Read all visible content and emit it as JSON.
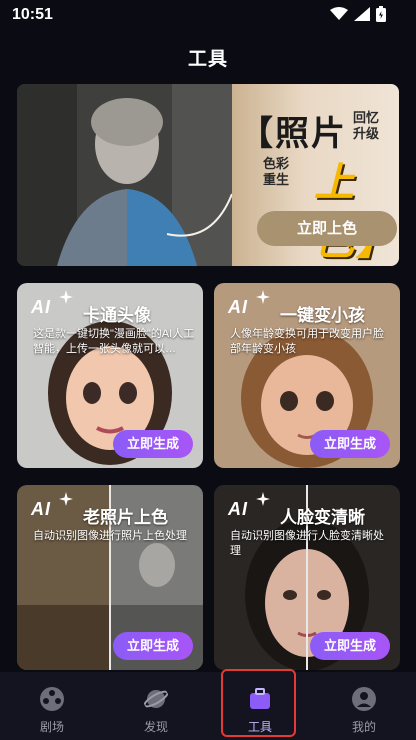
{
  "status": {
    "time": "10:51"
  },
  "header": {
    "title": "工具"
  },
  "banner": {
    "title_bracket": "【照片",
    "side_top": "回忆\n升级",
    "side_left": "色彩\n重生",
    "big_text": "上色】",
    "button_label": "立即上色"
  },
  "cards": [
    {
      "ai": "AI",
      "title": "卡通头像",
      "desc": "这是款一键切换\"漫画脸\"的AI人工智能，上传一张头像就可以…",
      "button": "立即生成"
    },
    {
      "ai": "AI",
      "title": "一键变小孩",
      "desc": "人像年龄变换可用于改变用户脸部年龄变小孩",
      "button": "立即生成"
    },
    {
      "ai": "AI",
      "title": "老照片上色",
      "desc": "自动识别图像进行照片上色处理",
      "button": "立即生成"
    },
    {
      "ai": "AI",
      "title": "人脸变清晰",
      "desc": "自动识别图像进行人脸变清晰处理",
      "button": "立即生成"
    }
  ],
  "nav": [
    {
      "label": "剧场",
      "icon": "film-reel-icon"
    },
    {
      "label": "发现",
      "icon": "planet-icon"
    },
    {
      "label": "工具",
      "icon": "toolbox-icon"
    },
    {
      "label": "我的",
      "icon": "profile-icon"
    }
  ],
  "colors": {
    "accent": "#8b5cf6",
    "banner_button": "#a8926f",
    "highlight": "#e53935"
  }
}
